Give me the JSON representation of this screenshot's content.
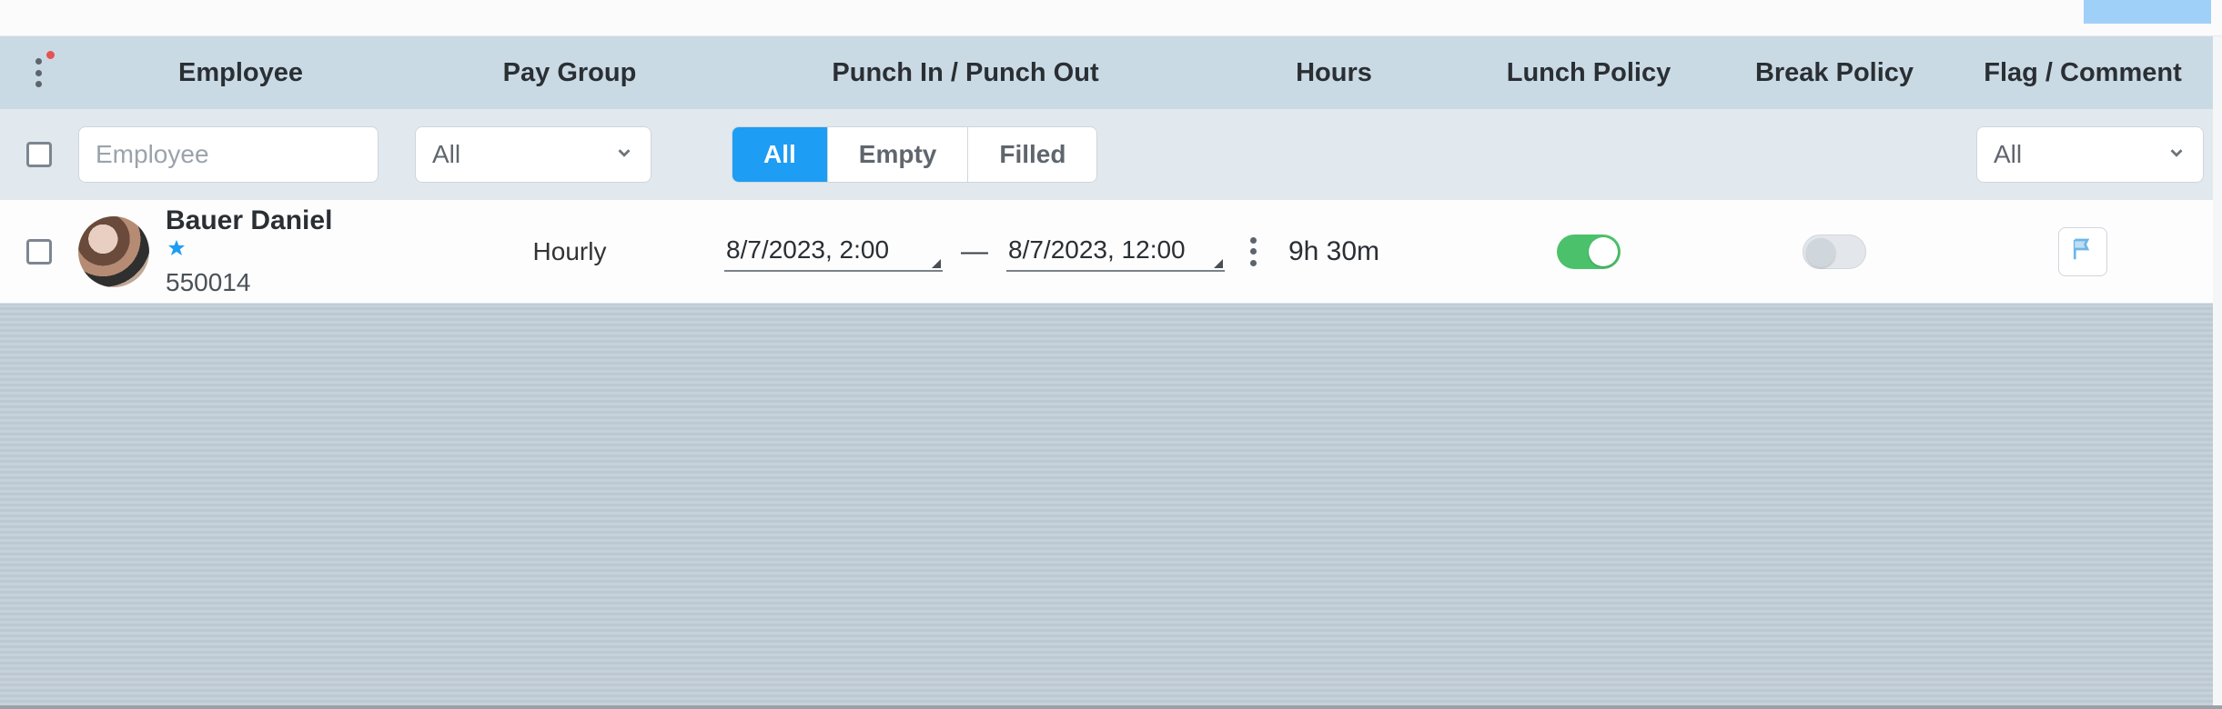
{
  "columns": {
    "employee": "Employee",
    "pay_group": "Pay Group",
    "punch": "Punch In / Punch Out",
    "hours": "Hours",
    "lunch": "Lunch Policy",
    "break": "Break Policy",
    "flag": "Flag / Comment"
  },
  "filters": {
    "employee_placeholder": "Employee",
    "pay_group_selected": "All",
    "punch_segments": {
      "all": "All",
      "empty": "Empty",
      "filled": "Filled"
    },
    "punch_active": "all",
    "flag_selected": "All"
  },
  "rows": [
    {
      "employee": {
        "name": "Bauer Daniel",
        "id": "550014"
      },
      "pay_group": "Hourly",
      "punch_in": "8/7/2023, 2:00",
      "punch_out": "8/7/2023, 12:00",
      "hours": "9h 30m",
      "lunch_on": true,
      "break_on": false
    }
  ],
  "misc": {
    "dash": "—"
  }
}
